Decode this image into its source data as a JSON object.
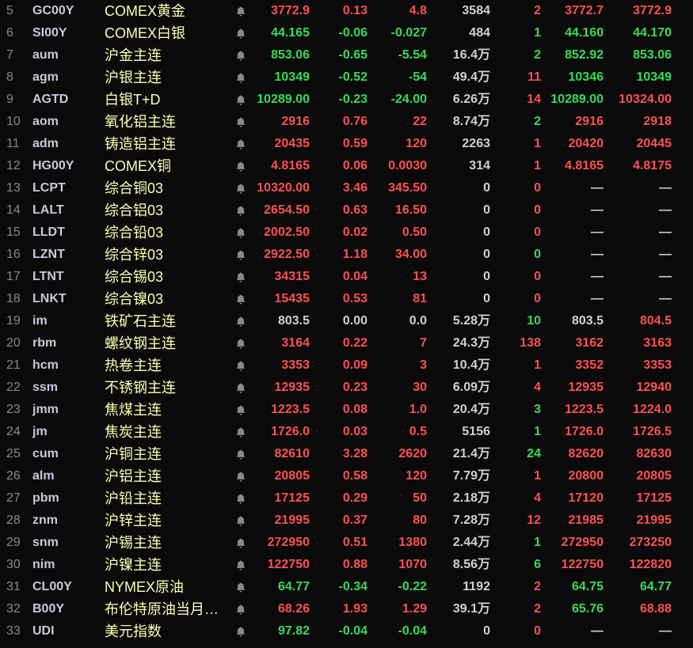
{
  "colors": {
    "up": "#ff5050",
    "down": "#33dd55",
    "flat": "#d0d0d0"
  },
  "rows": [
    {
      "idx": "5",
      "code": "GC00Y",
      "name": "COMEX黄金",
      "price": "3772.9",
      "pct": "0.13",
      "chg": "4.8",
      "vol": "3584",
      "cnt": "2",
      "bid": "3772.7",
      "ask": "3772.9",
      "c": "rrrrrr"
    },
    {
      "idx": "6",
      "code": "SI00Y",
      "name": "COMEX白银",
      "price": "44.165",
      "pct": "-0.06",
      "chg": "-0.027",
      "vol": "484",
      "cnt": "1",
      "bid": "44.160",
      "ask": "44.170",
      "c": "gggggg"
    },
    {
      "idx": "7",
      "code": "aum",
      "name": "沪金主连",
      "price": "853.06",
      "pct": "-0.65",
      "chg": "-5.54",
      "vol": "16.4万",
      "cnt": "2",
      "bid": "852.92",
      "ask": "853.06",
      "c": "gggggg"
    },
    {
      "idx": "8",
      "code": "agm",
      "name": "沪银主连",
      "price": "10349",
      "pct": "-0.52",
      "chg": "-54",
      "vol": "49.4万",
      "cnt": "11",
      "bid": "10346",
      "ask": "10349",
      "c": "gggrgg"
    },
    {
      "idx": "9",
      "code": "AGTD",
      "name": "白银T+D",
      "price": "10289.00",
      "pct": "-0.23",
      "chg": "-24.00",
      "vol": "6.26万",
      "cnt": "14",
      "bid": "10289.00",
      "ask": "10324.00",
      "c": "gggrgr"
    },
    {
      "idx": "10",
      "code": "aom",
      "name": "氧化铝主连",
      "price": "2916",
      "pct": "0.76",
      "chg": "22",
      "vol": "8.74万",
      "cnt": "2",
      "bid": "2916",
      "ask": "2918",
      "c": "rrrgrr"
    },
    {
      "idx": "11",
      "code": "adm",
      "name": "铸造铝主连",
      "price": "20435",
      "pct": "0.59",
      "chg": "120",
      "vol": "2263",
      "cnt": "1",
      "bid": "20420",
      "ask": "20445",
      "c": "rrrrrr"
    },
    {
      "idx": "12",
      "code": "HG00Y",
      "name": "COMEX铜",
      "price": "4.8165",
      "pct": "0.06",
      "chg": "0.0030",
      "vol": "314",
      "cnt": "1",
      "bid": "4.8165",
      "ask": "4.8175",
      "c": "rrrrrr"
    },
    {
      "idx": "13",
      "code": "LCPT",
      "name": "综合铜03",
      "price": "10320.00",
      "pct": "3.46",
      "chg": "345.50",
      "vol": "0",
      "cnt": "0",
      "bid": "—",
      "ask": "—",
      "c": "rrrrww"
    },
    {
      "idx": "14",
      "code": "LALT",
      "name": "综合铝03",
      "price": "2654.50",
      "pct": "0.63",
      "chg": "16.50",
      "vol": "0",
      "cnt": "0",
      "bid": "—",
      "ask": "—",
      "c": "rrrrww"
    },
    {
      "idx": "15",
      "code": "LLDT",
      "name": "综合铅03",
      "price": "2002.50",
      "pct": "0.02",
      "chg": "0.50",
      "vol": "0",
      "cnt": "0",
      "bid": "—",
      "ask": "—",
      "c": "rrrrww"
    },
    {
      "idx": "16",
      "code": "LZNT",
      "name": "综合锌03",
      "price": "2922.50",
      "pct": "1.18",
      "chg": "34.00",
      "vol": "0",
      "cnt": "0",
      "bid": "—",
      "ask": "—",
      "c": "rrrgww"
    },
    {
      "idx": "17",
      "code": "LTNT",
      "name": "综合锡03",
      "price": "34315",
      "pct": "0.04",
      "chg": "13",
      "vol": "0",
      "cnt": "0",
      "bid": "—",
      "ask": "—",
      "c": "rrrrww"
    },
    {
      "idx": "18",
      "code": "LNKT",
      "name": "综合镍03",
      "price": "15435",
      "pct": "0.53",
      "chg": "81",
      "vol": "0",
      "cnt": "0",
      "bid": "—",
      "ask": "—",
      "c": "rrrrww"
    },
    {
      "idx": "19",
      "code": "im",
      "name": "铁矿石主连",
      "price": "803.5",
      "pct": "0.00",
      "chg": "0.0",
      "vol": "5.28万",
      "cnt": "10",
      "bid": "803.5",
      "ask": "804.5",
      "c": "wwwgwr"
    },
    {
      "idx": "20",
      "code": "rbm",
      "name": "螺纹钢主连",
      "price": "3164",
      "pct": "0.22",
      "chg": "7",
      "vol": "24.3万",
      "cnt": "138",
      "bid": "3162",
      "ask": "3163",
      "c": "rrrrrr"
    },
    {
      "idx": "21",
      "code": "hcm",
      "name": "热卷主连",
      "price": "3353",
      "pct": "0.09",
      "chg": "3",
      "vol": "10.4万",
      "cnt": "1",
      "bid": "3352",
      "ask": "3353",
      "c": "rrrrrr"
    },
    {
      "idx": "22",
      "code": "ssm",
      "name": "不锈钢主连",
      "price": "12935",
      "pct": "0.23",
      "chg": "30",
      "vol": "6.09万",
      "cnt": "4",
      "bid": "12935",
      "ask": "12940",
      "c": "rrrrrr"
    },
    {
      "idx": "23",
      "code": "jmm",
      "name": "焦煤主连",
      "price": "1223.5",
      "pct": "0.08",
      "chg": "1.0",
      "vol": "20.4万",
      "cnt": "3",
      "bid": "1223.5",
      "ask": "1224.0",
      "c": "rrrgrr"
    },
    {
      "idx": "24",
      "code": "jm",
      "name": "焦炭主连",
      "price": "1726.0",
      "pct": "0.03",
      "chg": "0.5",
      "vol": "5156",
      "cnt": "1",
      "bid": "1726.0",
      "ask": "1726.5",
      "c": "rrrgrr"
    },
    {
      "idx": "25",
      "code": "cum",
      "name": "沪铜主连",
      "price": "82610",
      "pct": "3.28",
      "chg": "2620",
      "vol": "21.4万",
      "cnt": "24",
      "bid": "82620",
      "ask": "82630",
      "c": "rrrgrr"
    },
    {
      "idx": "26",
      "code": "alm",
      "name": "沪铝主连",
      "price": "20805",
      "pct": "0.58",
      "chg": "120",
      "vol": "7.79万",
      "cnt": "1",
      "bid": "20800",
      "ask": "20805",
      "c": "rrrrrr"
    },
    {
      "idx": "27",
      "code": "pbm",
      "name": "沪铅主连",
      "price": "17125",
      "pct": "0.29",
      "chg": "50",
      "vol": "2.18万",
      "cnt": "4",
      "bid": "17120",
      "ask": "17125",
      "c": "rrrrrr"
    },
    {
      "idx": "28",
      "code": "znm",
      "name": "沪锌主连",
      "price": "21995",
      "pct": "0.37",
      "chg": "80",
      "vol": "7.28万",
      "cnt": "12",
      "bid": "21985",
      "ask": "21995",
      "c": "rrrrrr"
    },
    {
      "idx": "29",
      "code": "snm",
      "name": "沪锡主连",
      "price": "272950",
      "pct": "0.51",
      "chg": "1380",
      "vol": "2.44万",
      "cnt": "1",
      "bid": "272950",
      "ask": "273250",
      "c": "rrrgrr"
    },
    {
      "idx": "30",
      "code": "nim",
      "name": "沪镍主连",
      "price": "122750",
      "pct": "0.88",
      "chg": "1070",
      "vol": "8.56万",
      "cnt": "6",
      "bid": "122750",
      "ask": "122820",
      "c": "rrrgrr"
    },
    {
      "idx": "31",
      "code": "CL00Y",
      "name": "NYMEX原油",
      "price": "64.77",
      "pct": "-0.34",
      "chg": "-0.22",
      "vol": "1192",
      "cnt": "2",
      "bid": "64.75",
      "ask": "64.77",
      "c": "gggrgg"
    },
    {
      "idx": "32",
      "code": "B00Y",
      "name": "布伦特原油当月…",
      "price": "68.26",
      "pct": "1.93",
      "chg": "1.29",
      "vol": "39.1万",
      "cnt": "2",
      "bid": "65.76",
      "ask": "68.88",
      "c": "rrrrgr"
    },
    {
      "idx": "33",
      "code": "UDI",
      "name": "美元指数",
      "price": "97.82",
      "pct": "-0.04",
      "chg": "-0.04",
      "vol": "0",
      "cnt": "0",
      "bid": "—",
      "ask": "—",
      "c": "gggrww"
    }
  ]
}
